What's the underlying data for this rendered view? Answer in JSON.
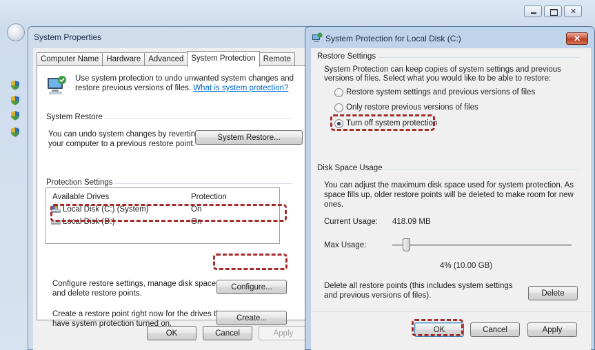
{
  "system_properties": {
    "title": "System Properties",
    "tabs": [
      {
        "label": "Computer Name"
      },
      {
        "label": "Hardware"
      },
      {
        "label": "Advanced"
      },
      {
        "label": "System Protection"
      },
      {
        "label": "Remote"
      }
    ],
    "intro_text_1": "Use system protection to undo unwanted system changes and",
    "intro_text_2": "restore previous versions of files.",
    "intro_link": "What is system protection?",
    "system_restore": {
      "heading": "System Restore",
      "text_1": "You can undo system changes by reverting",
      "text_2": "your computer to a previous restore point.",
      "button": "System Restore..."
    },
    "protection_settings": {
      "heading": "Protection Settings",
      "col_drives": "Available Drives",
      "col_protection": "Protection",
      "drives": [
        {
          "name": "Local Disk (C:) (System)",
          "protection": "On"
        },
        {
          "name": "Local Disk (D:)",
          "protection": "On"
        }
      ],
      "configure_text_1": "Configure restore settings, manage disk space,",
      "configure_text_2": "and delete restore points.",
      "configure_button": "Configure...",
      "create_text_1": "Create a restore point right now for the drives that",
      "create_text_2": "have system protection turned on.",
      "create_button": "Create..."
    },
    "buttons": {
      "ok": "OK",
      "cancel": "Cancel",
      "apply": "Apply"
    }
  },
  "system_protection": {
    "title": "System Protection for Local Disk (C:)",
    "restore_settings": {
      "heading": "Restore Settings",
      "text_1": "System Protection can keep copies of system settings and previous",
      "text_2": "versions of files. Select what you would like to be able to restore:",
      "options": [
        {
          "label": "Restore system settings and previous versions of files",
          "checked": false
        },
        {
          "label": "Only restore previous versions of files",
          "checked": false
        },
        {
          "label": "Turn off system protection",
          "checked": true
        }
      ]
    },
    "disk_space": {
      "heading": "Disk Space Usage",
      "text_1": "You can adjust the maximum disk space used for system protection. As",
      "text_2": "space fills up, older restore points will be deleted to make room for new",
      "text_3": "ones.",
      "current_usage_label": "Current Usage:",
      "current_usage_value": "418.09 MB",
      "max_usage_label": "Max Usage:",
      "max_usage_fraction": 0.04,
      "max_usage_value": "4% (10.00 GB)",
      "delete_text_1": "Delete all restore points (this includes system settings",
      "delete_text_2": "and previous versions of files).",
      "delete_button": "Delete"
    },
    "buttons": {
      "ok": "OK",
      "cancel": "Cancel",
      "apply": "Apply"
    }
  },
  "colors": {
    "highlight": "#a52a2a",
    "link": "#0066cc"
  }
}
